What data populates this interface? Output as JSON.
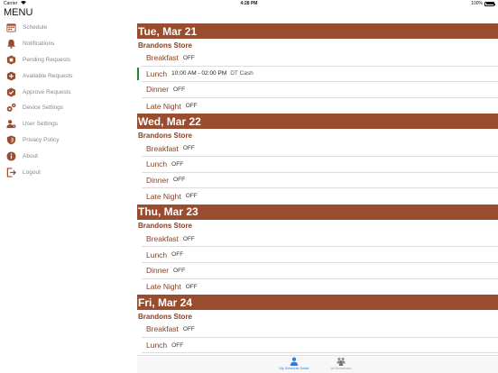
{
  "status_bar": {
    "carrier": "Carrier",
    "time": "4:28 PM",
    "battery": "100%"
  },
  "menu": {
    "title": "MENU",
    "items": [
      {
        "label": "Schedule",
        "icon": "calendar-icon"
      },
      {
        "label": "Notifications",
        "icon": "bell-icon"
      },
      {
        "label": "Pending Requests",
        "icon": "pending-tag-icon"
      },
      {
        "label": "Available Requests",
        "icon": "available-tag-icon"
      },
      {
        "label": "Approve Requests",
        "icon": "approve-check-icon"
      },
      {
        "label": "Device Settings",
        "icon": "gears-icon"
      },
      {
        "label": "User Settings",
        "icon": "user-gear-icon"
      },
      {
        "label": "Privacy Policy",
        "icon": "shield-icon"
      },
      {
        "label": "About",
        "icon": "info-icon"
      },
      {
        "label": "Logout",
        "icon": "logout-icon"
      }
    ]
  },
  "days": [
    {
      "date": "Tue, Mar 21",
      "store": "Brandons Store",
      "shifts": [
        {
          "name": "Breakfast",
          "value": "OFF"
        },
        {
          "name": "Lunch",
          "value": "10:00 AM - 02:00 PM",
          "extra": "DT Cash",
          "active": true
        },
        {
          "name": "Dinner",
          "value": "OFF"
        },
        {
          "name": "Late Night",
          "value": "OFF"
        }
      ]
    },
    {
      "date": "Wed, Mar 22",
      "store": "Brandons Store",
      "shifts": [
        {
          "name": "Breakfast",
          "value": "OFF"
        },
        {
          "name": "Lunch",
          "value": "OFF"
        },
        {
          "name": "Dinner",
          "value": "OFF"
        },
        {
          "name": "Late Night",
          "value": "OFF"
        }
      ]
    },
    {
      "date": "Thu, Mar 23",
      "store": "Brandons Store",
      "shifts": [
        {
          "name": "Breakfast",
          "value": "OFF"
        },
        {
          "name": "Lunch",
          "value": "OFF"
        },
        {
          "name": "Dinner",
          "value": "OFF"
        },
        {
          "name": "Late Night",
          "value": "OFF"
        }
      ]
    },
    {
      "date": "Fri, Mar 24",
      "store": "Brandons Store",
      "shifts": [
        {
          "name": "Breakfast",
          "value": "OFF"
        },
        {
          "name": "Lunch",
          "value": "OFF"
        }
      ]
    }
  ],
  "tabs": [
    {
      "label": "My Schedule Detail",
      "icon": "person-icon",
      "selected": true
    },
    {
      "label": "All Schedules",
      "icon": "group-icon",
      "selected": false
    }
  ],
  "colors": {
    "accent": "#9a4c2e",
    "active_marker": "#1e8c2e",
    "tab_selected": "#2a7fe0"
  }
}
